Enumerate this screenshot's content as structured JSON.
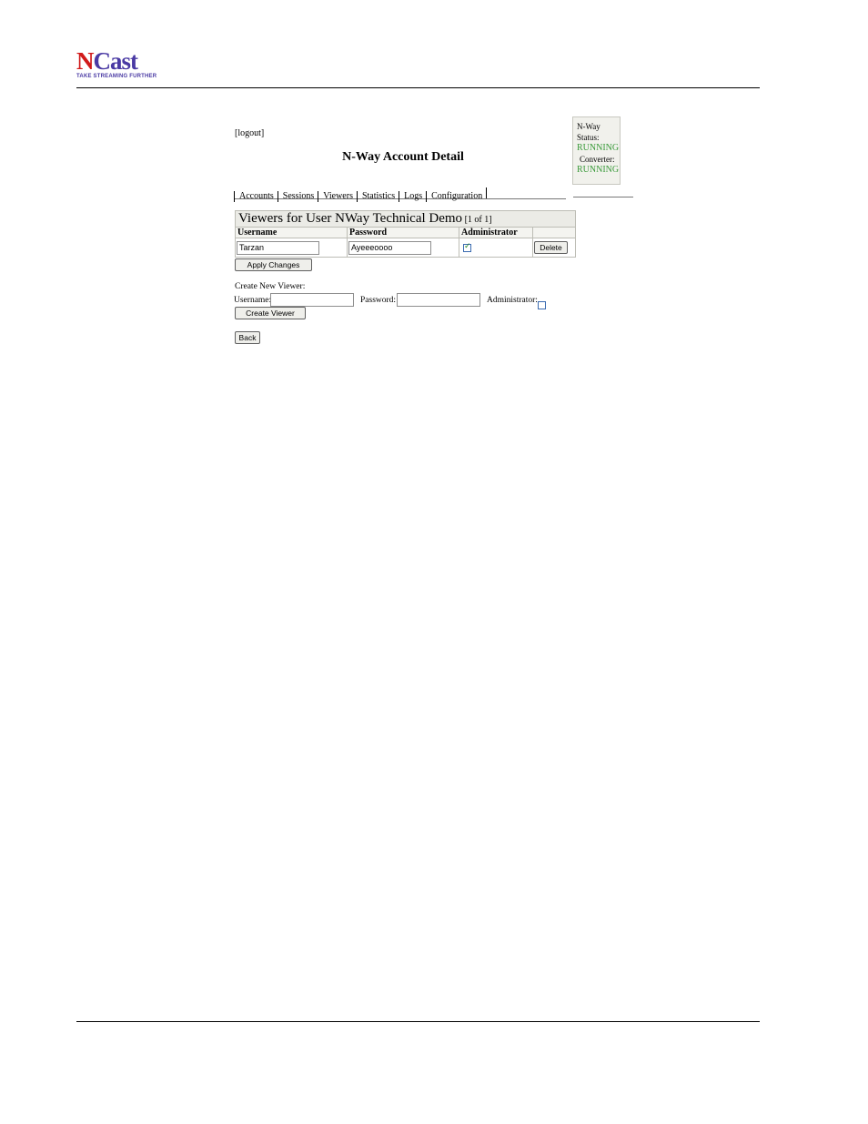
{
  "logo": {
    "n": "N",
    "rest": "Cast",
    "tagline": "TAKE STREAMING FURTHER"
  },
  "page": {
    "logout": "[logout]",
    "title": "N-Way Account Detail"
  },
  "status": {
    "nway_label": "N-Way",
    "status_label": "Status:",
    "nway_status": "RUNNING",
    "converter_label": "Converter:",
    "converter_status": "RUNNING",
    "status_color": "#3a9a3a"
  },
  "tabs": [
    "Accounts",
    "Sessions",
    "Viewers",
    "Statistics",
    "Logs",
    "Configuration"
  ],
  "viewers_table": {
    "title": "Viewers for User NWay Technical Demo",
    "count": "[1 of 1]",
    "headers": [
      "Username",
      "Password",
      "Administrator",
      ""
    ],
    "rows": [
      {
        "username": "Tarzan",
        "password": "Ayeeeoooo",
        "administrator": true,
        "action": "Delete"
      }
    ]
  },
  "buttons": {
    "apply": "Apply Changes",
    "create": "Create Viewer",
    "back": "Back"
  },
  "create_form": {
    "heading": "Create New Viewer:",
    "username_label": "Username:",
    "username_value": "",
    "password_label": "Password:",
    "password_value": "",
    "administrator_label": "Administrator:",
    "administrator": false
  }
}
